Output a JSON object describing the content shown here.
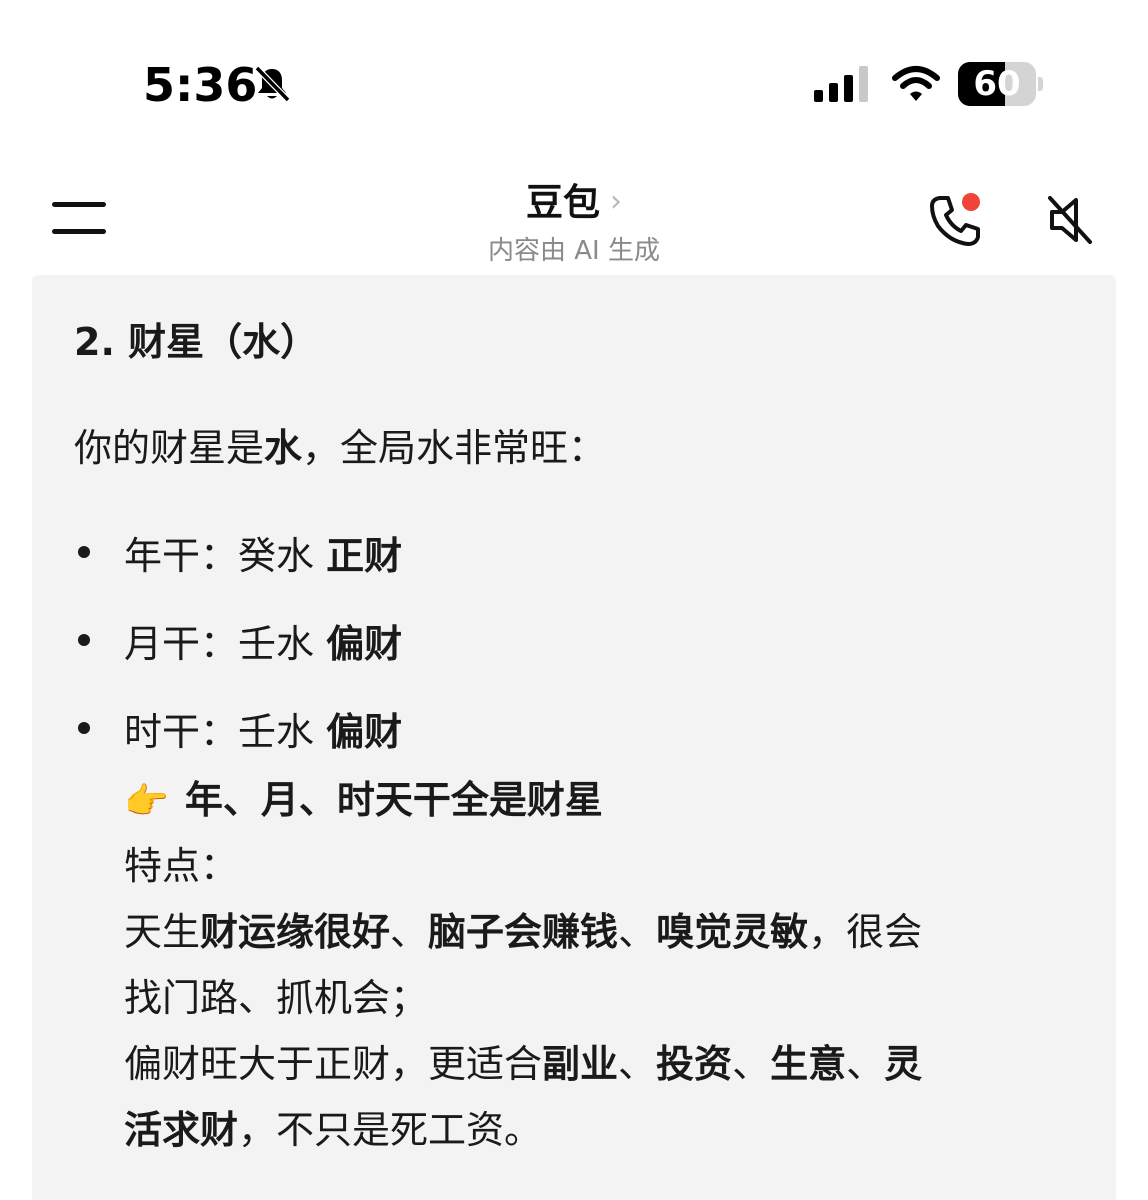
{
  "status_bar": {
    "time": "5:36",
    "battery": "60",
    "battery_level": 0.6,
    "icons": [
      "bell-off-icon",
      "signal-icon",
      "wifi-icon",
      "battery-icon"
    ]
  },
  "header": {
    "title": "豆包",
    "chevron": "›",
    "subtitle": "内容由 AI 生成",
    "icons": [
      "menu-icon",
      "phone-icon",
      "mute-icon"
    ],
    "call_dot_color": "#f04438"
  },
  "message": {
    "heading": "2. 财星（水）",
    "intro": {
      "before": "你的财星是",
      "bold": "水",
      "after": "，全局水非常旺："
    },
    "bullets": [
      {
        "label": "年干：",
        "value": "癸水 ",
        "bold": "正财"
      },
      {
        "label": "月干：",
        "value": "壬水 ",
        "bold": "偏财"
      },
      {
        "label": "时干：",
        "value": "壬水 ",
        "bold": "偏财"
      }
    ],
    "pointer_icon": "👉",
    "pointer_text": "年、月、时天干全是财星",
    "features_label": "特点：",
    "line1": {
      "a": "天生",
      "b": "财运缘很好",
      "c": "、",
      "d": "脑子会赚钱",
      "e": "、",
      "f": "嗅觉灵敏",
      "g": "，很会"
    },
    "line2": "找门路、抓机会；",
    "line3": {
      "a": "偏财旺大于正财，更适合",
      "b": "副业",
      "c": "、",
      "d": "投资",
      "e": "、",
      "f": "生意",
      "g": "、",
      "h": "灵"
    },
    "line4": {
      "a": "活求财",
      "b": "，不只是死工资。"
    }
  },
  "colors": {
    "panel_bg": "#f3f3f3",
    "text": "#1a1a1a",
    "subtitle": "#8a8a8a"
  }
}
